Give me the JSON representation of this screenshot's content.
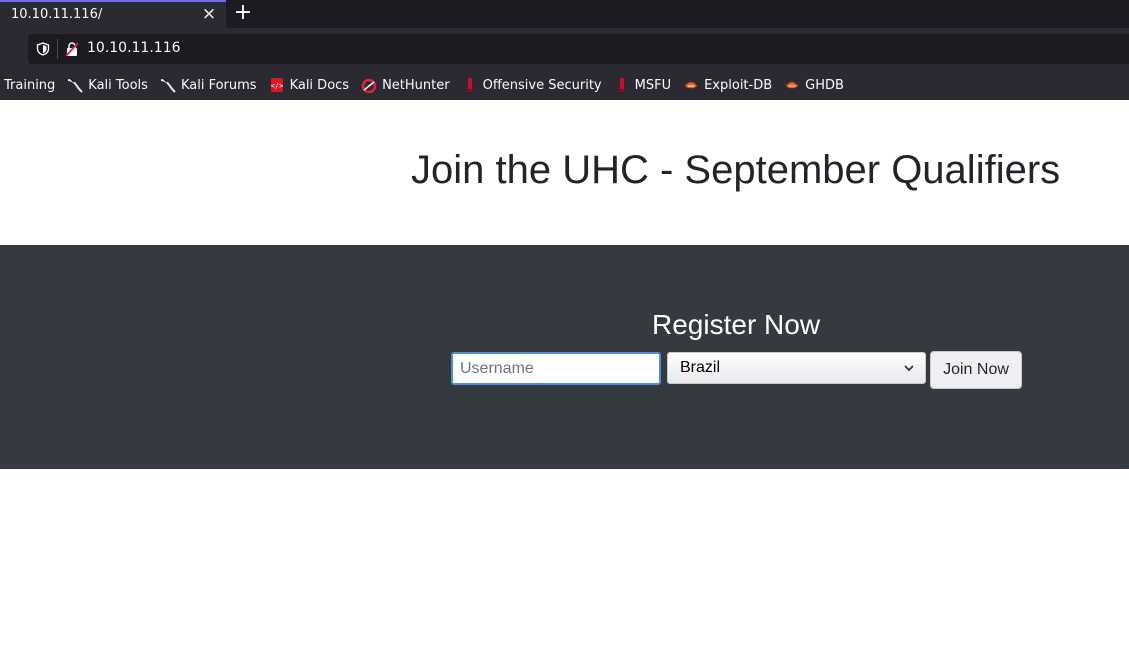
{
  "browser": {
    "tab_title": "10.10.11.116/",
    "tab_close": "×",
    "new_tab": "+",
    "url": "10.10.11.116"
  },
  "bookmarks": [
    {
      "label": "Training",
      "icon": "none"
    },
    {
      "label": "Kali Tools",
      "icon": "kali-dragon-icon"
    },
    {
      "label": "Kali Forums",
      "icon": "kali-dragon-icon"
    },
    {
      "label": "Kali Docs",
      "icon": "kali-docs-icon"
    },
    {
      "label": "NetHunter",
      "icon": "nethunter-icon"
    },
    {
      "label": "Offensive Security",
      "icon": "offsec-icon"
    },
    {
      "label": "MSFU",
      "icon": "offsec-icon"
    },
    {
      "label": "Exploit-DB",
      "icon": "exploitdb-icon"
    },
    {
      "label": "GHDB",
      "icon": "exploitdb-icon"
    }
  ],
  "page": {
    "headline": "Join the UHC - September Qualifiers",
    "register_title": "Register Now",
    "username_placeholder": "Username",
    "username_value": "",
    "country_selected": "Brazil",
    "join_button": "Join Now"
  },
  "colors": {
    "chrome_dark": "#1c1b22",
    "chrome": "#2b2a33",
    "band": "#343a40",
    "focus_border": "#4a90d9"
  }
}
